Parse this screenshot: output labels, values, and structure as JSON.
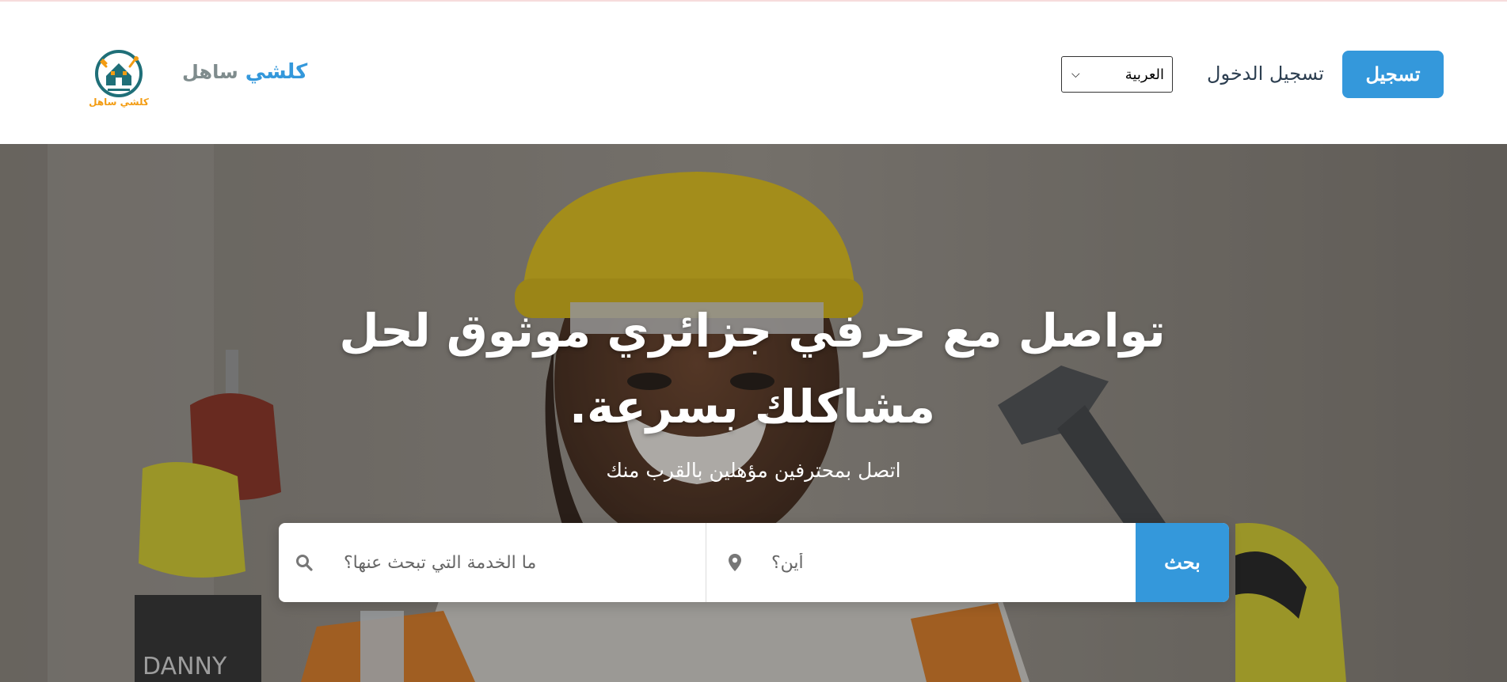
{
  "header": {
    "logo_text": "كلشي ساهل",
    "brand": {
      "part1": "كلشي",
      "part2": "ساهل"
    },
    "language_selected": "العربية",
    "login_label": "تسجيل الدخول",
    "register_label": "تسجيل"
  },
  "hero": {
    "title": "تواصل مع حرفي جزائري موثوق لحل مشاكلك بسرعة.",
    "subtitle": "اتصل بمحترفين مؤهلين بالقرب منك",
    "search": {
      "service_placeholder": "ما الخدمة التي تبحث عنها؟",
      "location_placeholder": "أين؟",
      "submit_label": "بحث"
    }
  },
  "colors": {
    "accent": "#3498db",
    "brand_gray": "#7f8c8d",
    "logo_teal": "#1f6f78",
    "logo_orange": "#f39c12"
  },
  "icons": [
    "logo-house-tools-icon",
    "chevron-down-icon",
    "map-pin-icon",
    "search-icon"
  ]
}
